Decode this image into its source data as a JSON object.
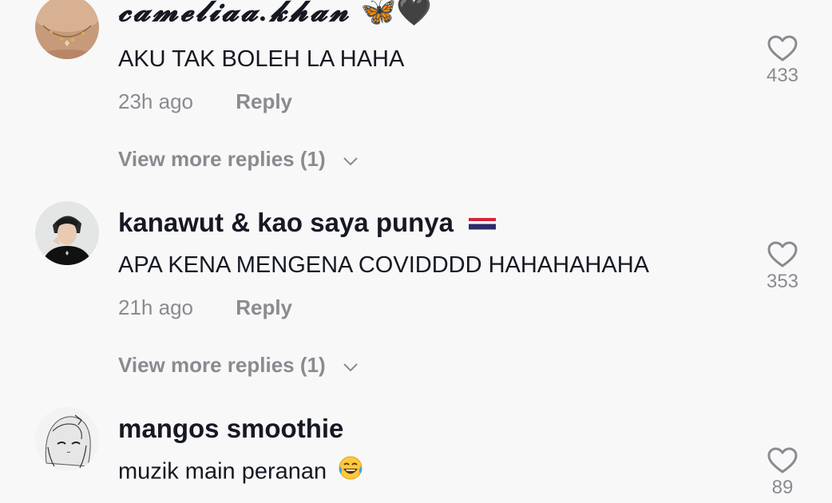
{
  "comments": [
    {
      "username": "𝓬𝓪𝓶𝓮𝓵𝓲𝓪𝓪.𝓴𝓱𝓪𝓷",
      "username_emoji": "🦋🖤",
      "text": "AKU TAK BOLEH LA HAHA",
      "time": "23h ago",
      "reply_label": "Reply",
      "more_replies": "View more replies (1)",
      "likes": "433"
    },
    {
      "username": "kanawut & kao saya punya",
      "username_emoji": "thailand-flag",
      "text": "APA KENA MENGENA COVIDDDD HAHAHAHAHA",
      "time": "21h ago",
      "reply_label": "Reply",
      "more_replies": "View more replies (1)",
      "likes": "353"
    },
    {
      "username": "mangos smoothie",
      "text": "muzik main peranan",
      "text_emoji": "laughing-tears-emoji",
      "likes": "89"
    }
  ],
  "icons": {
    "like": "heart-outline-icon",
    "expand": "chevron-down-icon"
  },
  "colors": {
    "background": "#f8f8f8",
    "primary_text": "#161823",
    "secondary_text": "#8a8b91"
  }
}
